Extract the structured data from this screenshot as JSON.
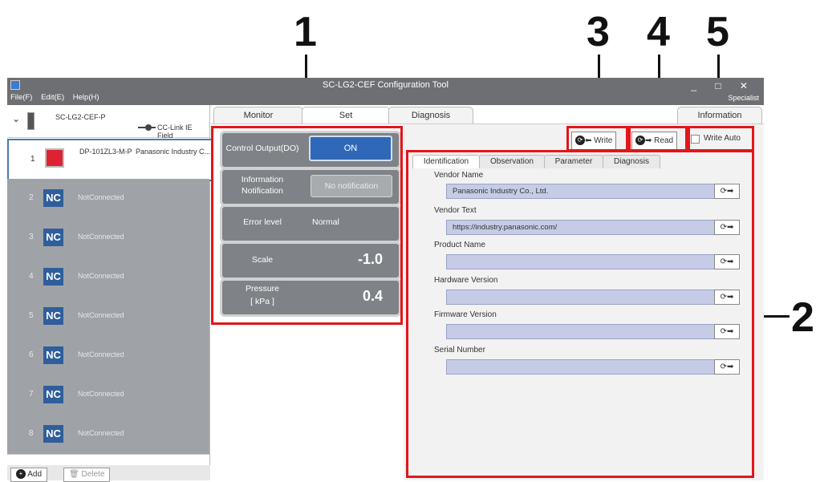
{
  "callouts": [
    "1",
    "2",
    "3",
    "4",
    "5"
  ],
  "window": {
    "title": "SC-LG2-CEF Configuration Tool",
    "menu": [
      "File(F)",
      "Edit(E)",
      "Help(H)"
    ],
    "mode": "Specialist",
    "controls": "_ □ ✕"
  },
  "tree": {
    "root": "SC-LG2-CEF-P",
    "network": "CC-Link IE Field",
    "selected": {
      "index": "1",
      "model": "DP-101ZL3-M-P",
      "vendor": "Panasonic Industry C..."
    },
    "nc_rows": [
      {
        "index": "2",
        "badge": "NC",
        "name": "NotConnected"
      },
      {
        "index": "3",
        "badge": "NC",
        "name": "NotConnected"
      },
      {
        "index": "4",
        "badge": "NC",
        "name": "NotConnected"
      },
      {
        "index": "5",
        "badge": "NC",
        "name": "NotConnected"
      },
      {
        "index": "6",
        "badge": "NC",
        "name": "NotConnected"
      },
      {
        "index": "7",
        "badge": "NC",
        "name": "NotConnected"
      },
      {
        "index": "8",
        "badge": "NC",
        "name": "NotConnected"
      }
    ],
    "add_label": "Add",
    "delete_label": "Delete"
  },
  "tabs": [
    "Monitor",
    "Set",
    "Diagnosis",
    "Information"
  ],
  "set_panel": {
    "control_output_label": "Control Output(DO)",
    "control_output_value": "ON",
    "info_label": "Information Notification",
    "info_value": "No notification",
    "error_label": "Error level",
    "error_value": "Normal",
    "scale_label": "Scale",
    "scale_value": "-1.0",
    "pressure_label": "Pressure",
    "pressure_unit": "[ kPa ]",
    "pressure_value": "0.4"
  },
  "toolbar": {
    "write": "Write",
    "read": "Read",
    "write_auto": "Write Auto"
  },
  "subtabs": [
    "Identification",
    "Observation",
    "Parameter",
    "Diagnosis"
  ],
  "fields": [
    {
      "label": "Vendor Name",
      "value": "Panasonic Industry Co., Ltd."
    },
    {
      "label": "Vendor Text",
      "value": "https://industry.panasonic.com/"
    },
    {
      "label": "Product Name",
      "value": ""
    },
    {
      "label": "Hardware Version",
      "value": ""
    },
    {
      "label": "Firmware Version",
      "value": ""
    },
    {
      "label": "Serial Number",
      "value": ""
    }
  ],
  "colors": {
    "annotation_red": "#e3161b",
    "titlebar": "#6d6f72",
    "nc_badge": "#2f5e9b",
    "on_button": "#2f68b6",
    "field_fill": "#c6cce6"
  }
}
